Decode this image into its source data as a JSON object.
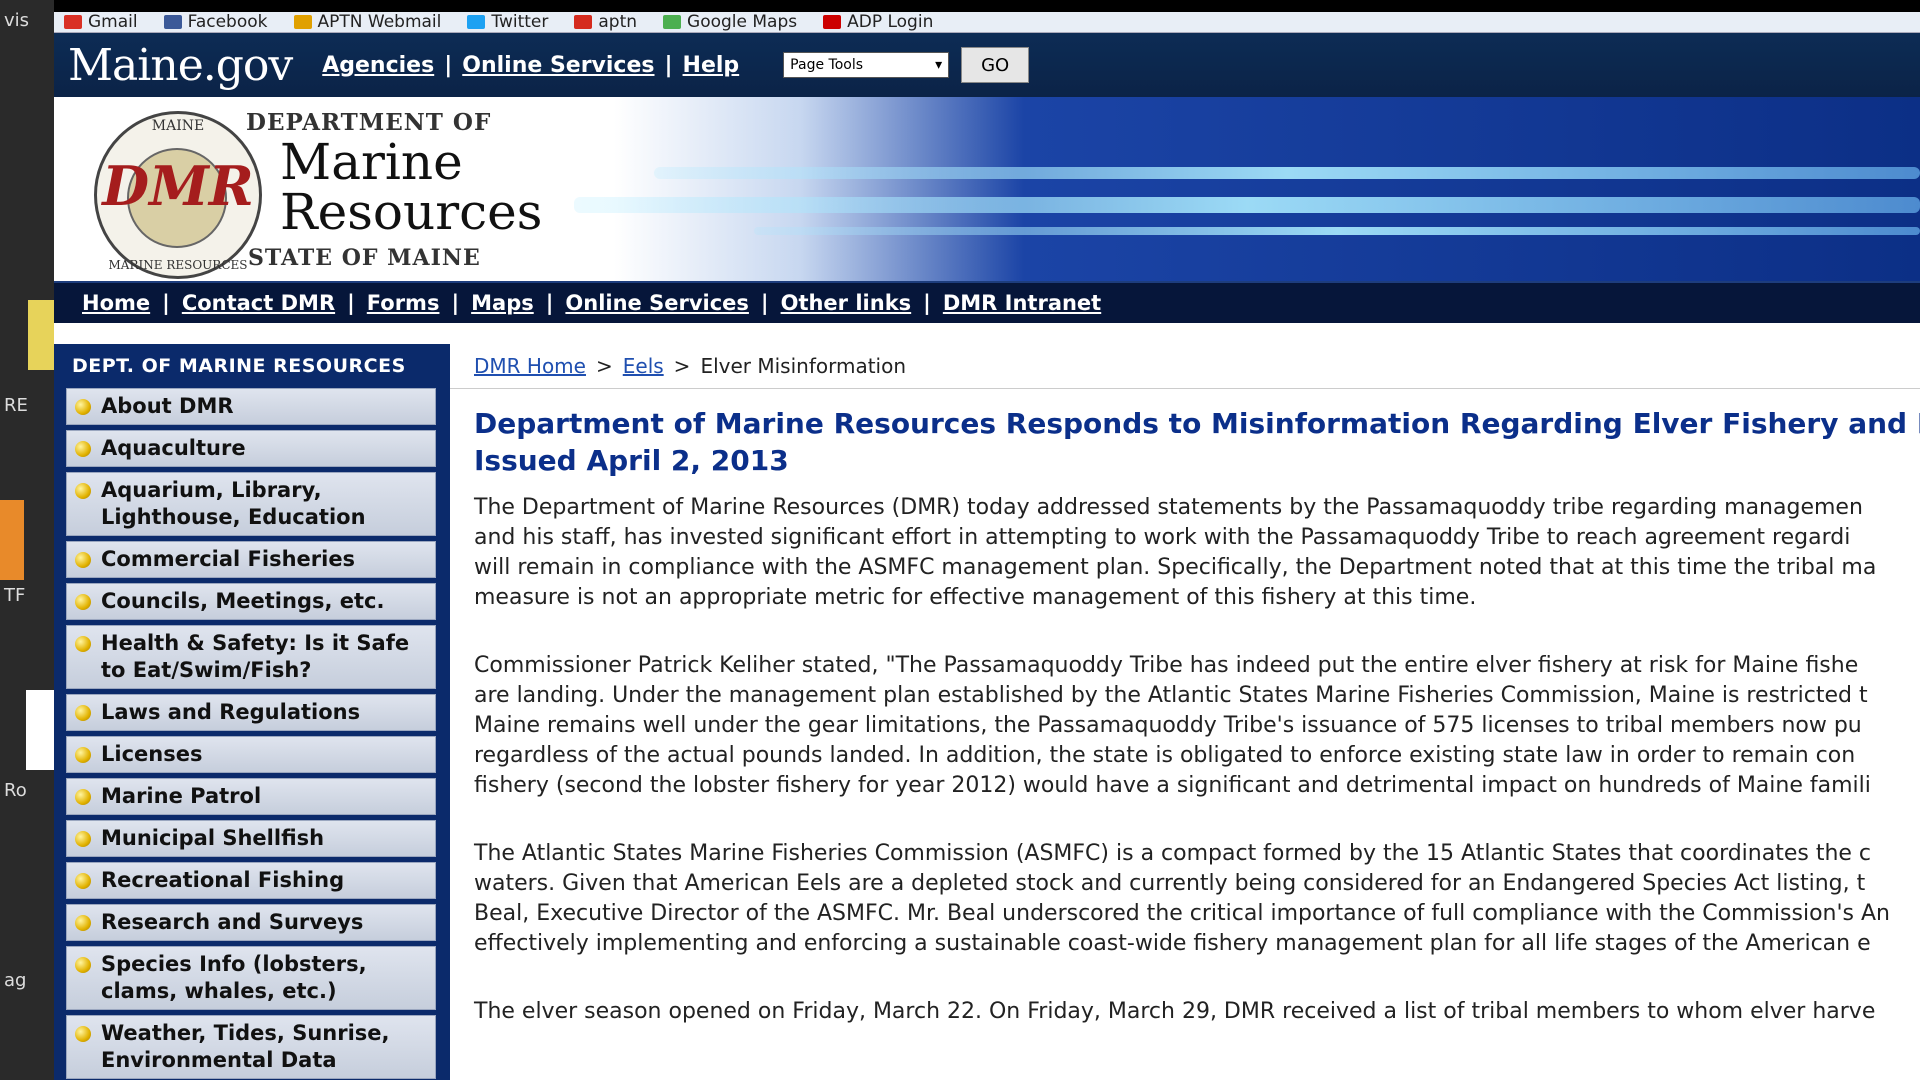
{
  "left_fragments": [
    "vis",
    "RE",
    "TF",
    "Ro",
    "ag"
  ],
  "bookmarks": [
    {
      "label": "Gmail",
      "color": "#d93025"
    },
    {
      "label": "Facebook",
      "color": "#3b5998"
    },
    {
      "label": "APTN Webmail",
      "color": "#e0a000"
    },
    {
      "label": "Twitter",
      "color": "#1da1f2"
    },
    {
      "label": "aptn",
      "color": "#d52b1e"
    },
    {
      "label": "Google Maps",
      "color": "#4caf50"
    },
    {
      "label": "ADP Login",
      "color": "#cc0000"
    }
  ],
  "top": {
    "logo": "Maine.gov",
    "links": [
      "Agencies",
      "Online Services",
      "Help"
    ],
    "page_tools": "Page Tools",
    "go": "GO"
  },
  "banner": {
    "dept_of": "DEPARTMENT OF",
    "title_line1": "Marine",
    "title_line2": "Resources",
    "state": "STATE OF MAINE",
    "seal_letters": "DMR",
    "seal_top": "MAINE",
    "seal_bottom": "MARINE RESOURCES"
  },
  "nav": [
    "Home",
    "Contact DMR",
    "Forms",
    "Maps",
    "Online Services",
    "Other links",
    "DMR Intranet"
  ],
  "sidebar": {
    "title": "DEPT. OF MARINE RESOURCES",
    "items": [
      "About DMR",
      "Aquaculture",
      "Aquarium, Library, Lighthouse, Education",
      "Commercial Fisheries",
      "Councils, Meetings, etc.",
      "Health & Safety: Is it Safe to Eat/Swim/Fish?",
      "Laws and Regulations",
      "Licenses",
      "Marine Patrol",
      "Municipal Shellfish",
      "Recreational Fishing",
      "Research and Surveys",
      "Species Info (lobsters, clams, whales, etc.)",
      "Weather, Tides, Sunrise, Environmental Data"
    ]
  },
  "breadcrumb": {
    "home": "DMR Home",
    "eels": "Eels",
    "current": "Elver Misinformation",
    "sep": ">"
  },
  "article": {
    "headline_line1": "Department of Marine Resources Responds to Misinformation Regarding Elver Fishery and P",
    "headline_line2": "Issued April 2, 2013",
    "paragraphs": [
      [
        "The Department of Marine Resources (DMR) today addressed statements by the Passamaquoddy tribe regarding managemen",
        "and his staff, has invested significant effort in attempting to work with the Passamaquoddy Tribe to reach agreement regardi",
        "will remain in compliance with the ASMFC management plan. Specifically, the Department noted that at this time the tribal ma",
        "measure is not an appropriate metric for effective management of this fishery at this time."
      ],
      [
        "Commissioner Patrick Keliher stated, \"The Passamaquoddy Tribe has indeed put the entire elver fishery at risk for Maine fishe",
        "are landing. Under the management plan established by the Atlantic States Marine Fisheries Commission, Maine is restricted t",
        "Maine remains well under the gear limitations, the Passamaquoddy Tribe's issuance of 575 licenses to tribal members now pu",
        "regardless of the actual pounds landed. In addition, the state is obligated to enforce existing state law in order to remain con",
        "fishery (second the lobster fishery for year 2012) would have a significant and detrimental impact on hundreds of Maine famili"
      ],
      [
        "The Atlantic States Marine Fisheries Commission (ASMFC) is a compact formed by the 15 Atlantic States that coordinates the c",
        "waters. Given that American Eels are a depleted stock and currently being considered for an Endangered Species Act listing, t",
        "Beal, Executive Director of the ASMFC. Mr. Beal underscored the critical importance of full compliance with the Commission's An",
        "effectively implementing and enforcing a sustainable coast-wide fishery management plan for all life stages of the American e"
      ],
      [
        "The elver season opened on Friday, March 22. On Friday, March 29, DMR received a list of tribal members to whom elver harve"
      ]
    ]
  }
}
